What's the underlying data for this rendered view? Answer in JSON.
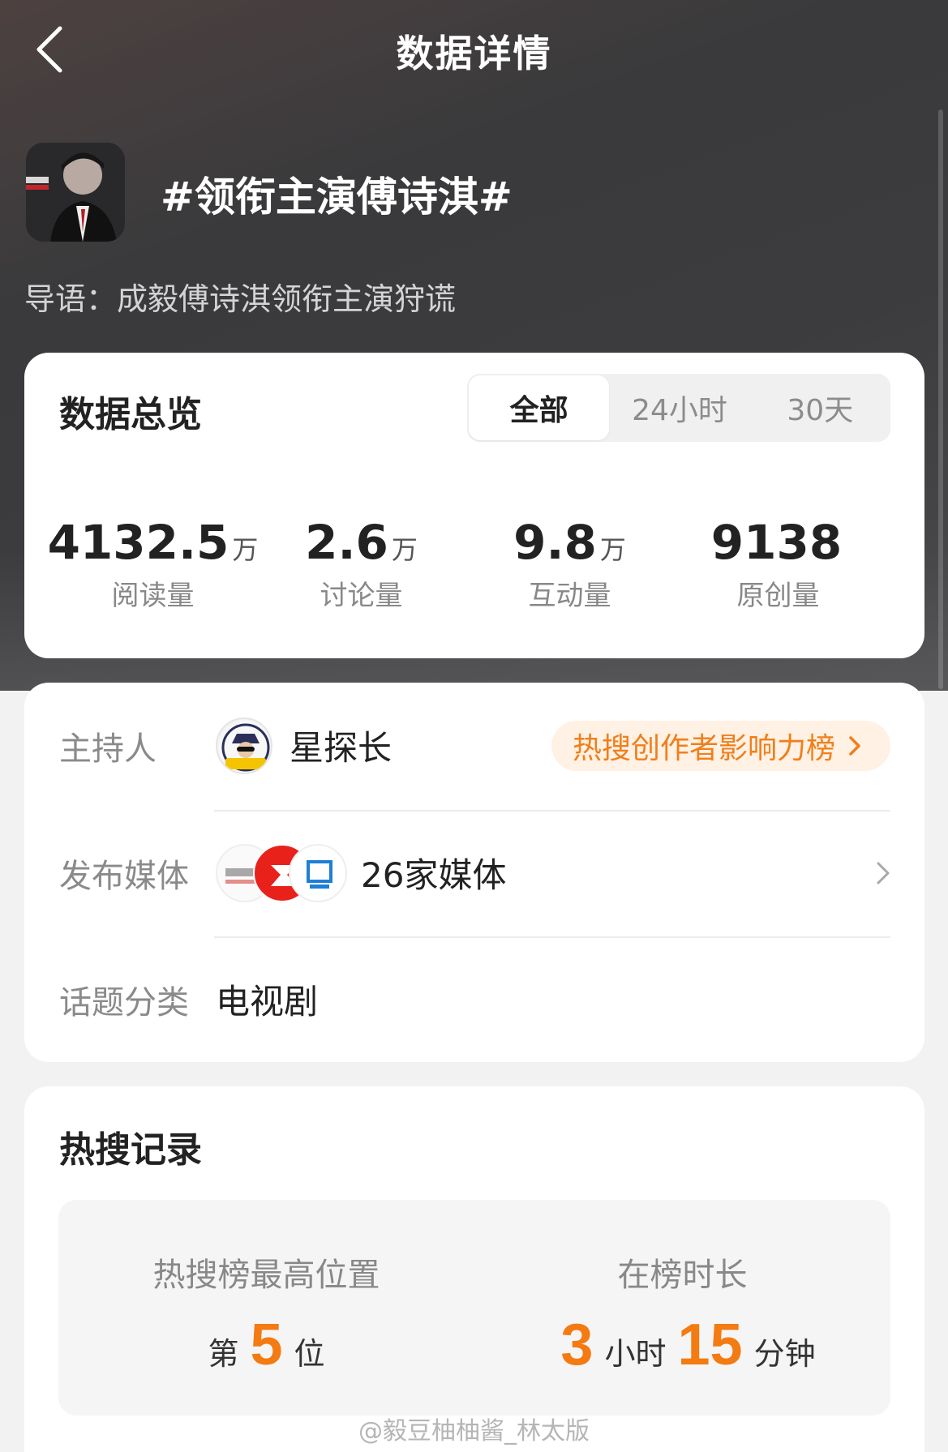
{
  "header": {
    "back_icon": "chevron-left-icon",
    "title": "数据详情"
  },
  "topic": {
    "title": "#领衔主演傅诗淇#",
    "lead": "导语：成毅傅诗淇领衔主演狩谎"
  },
  "overview": {
    "heading": "数据总览",
    "tabs": [
      {
        "label": "全部",
        "active": true
      },
      {
        "label": "24小时",
        "active": false
      },
      {
        "label": "30天",
        "active": false
      }
    ],
    "stats": [
      {
        "value": "4132.5",
        "unit": "万",
        "label": "阅读量"
      },
      {
        "value": "2.6",
        "unit": "万",
        "label": "讨论量"
      },
      {
        "value": "9.8",
        "unit": "万",
        "label": "互动量"
      },
      {
        "value": "9138",
        "unit": "",
        "label": "原创量"
      }
    ]
  },
  "info": {
    "host_label": "主持人",
    "host_name": "星探长",
    "rank_link": "热搜创作者影响力榜",
    "media_label": "发布媒体",
    "media_count": "26家媒体",
    "category_label": "话题分类",
    "category": "电视剧"
  },
  "record": {
    "heading": "热搜记录",
    "peak_label": "热搜榜最高位置",
    "peak_prefix": "第",
    "peak_value": "5",
    "peak_suffix": "位",
    "duration_label": "在榜时长",
    "hours": "3",
    "hours_unit": "小时",
    "minutes": "15",
    "minutes_unit": "分钟"
  },
  "watermark": "@毅豆柚柚酱_林太版",
  "colors": {
    "accent": "#f47a12",
    "pill_bg": "#fff1e4",
    "pill_text": "#f07f1b"
  }
}
